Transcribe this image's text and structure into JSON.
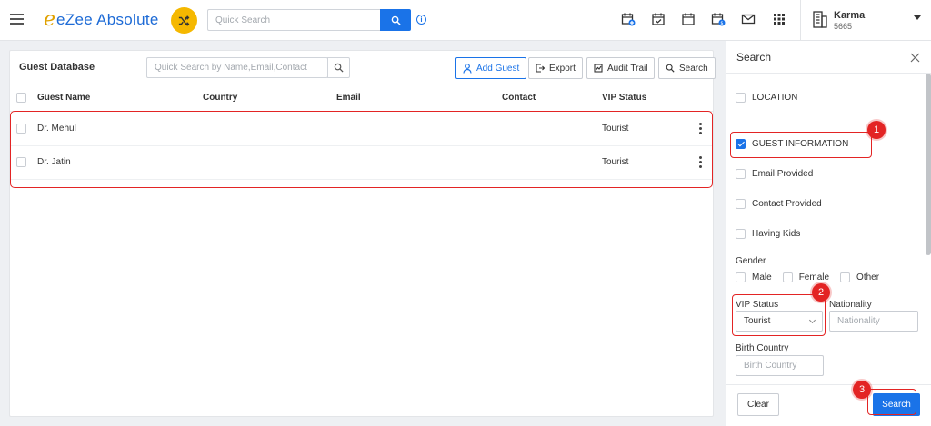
{
  "topbar": {
    "brand_mark": "e",
    "brand_text": "eZee Absolute",
    "search_placeholder": "Quick Search",
    "icons": [
      "calendar-plus-icon",
      "calendar-check-icon",
      "calendar-icon",
      "calendar-dollar-icon",
      "mail-icon",
      "apps-grid-icon"
    ],
    "user": {
      "name": "Karma",
      "code": "5665"
    }
  },
  "guest_panel": {
    "title": "Guest Database",
    "search_placeholder": "Quick Search by Name,Email,Contact",
    "buttons": {
      "add_guest": "Add Guest",
      "export": "Export",
      "audit_trail": "Audit Trail",
      "search": "Search"
    },
    "columns": {
      "name": "Guest Name",
      "country": "Country",
      "email": "Email",
      "contact": "Contact",
      "vip": "VIP Status"
    },
    "rows": [
      {
        "name": "Dr. Mehul",
        "country": "",
        "email": "",
        "contact": "",
        "vip": "Tourist"
      },
      {
        "name": "Dr. Jatin",
        "country": "",
        "email": "",
        "contact": "",
        "vip": "Tourist"
      }
    ]
  },
  "search_drawer": {
    "title": "Search",
    "location_label": "LOCATION",
    "guest_info_label": "GUEST INFORMATION",
    "guest_info_checked": true,
    "email_provided_label": "Email Provided",
    "contact_provided_label": "Contact Provided",
    "having_kids_label": "Having Kids",
    "gender_label": "Gender",
    "gender_options": [
      "Male",
      "Female",
      "Other"
    ],
    "vip_status_label": "VIP Status",
    "vip_status_value": "Tourist",
    "nationality_label": "Nationality",
    "nationality_placeholder": "Nationality",
    "birth_country_label": "Birth Country",
    "birth_country_placeholder": "Birth Country",
    "clear_label": "Clear",
    "search_label": "Search"
  },
  "annotations": [
    "1",
    "2",
    "3"
  ],
  "colors": {
    "accent": "#1a73e8",
    "brand_yellow": "#f5b800",
    "annotation_red": "#e32424"
  }
}
